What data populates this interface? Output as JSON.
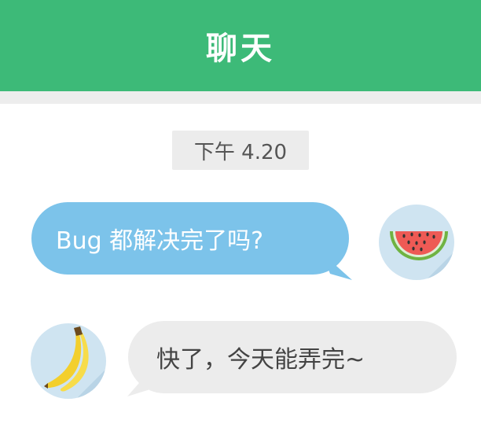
{
  "header": {
    "title": "聊天"
  },
  "timestamp": {
    "text": "下午 4.20"
  },
  "messages": [
    {
      "sender": "me",
      "text": "Bug 都解决完了吗?",
      "avatar_icon": "watermelon-icon"
    },
    {
      "sender": "other",
      "text": "快了，今天能弄完~",
      "avatar_icon": "banana-icon"
    }
  ],
  "colors": {
    "header_bg": "#3dba78",
    "sent_bubble": "#7cc3ea",
    "received_bubble": "#ececec",
    "avatar_bg": "#cfe4f1"
  }
}
